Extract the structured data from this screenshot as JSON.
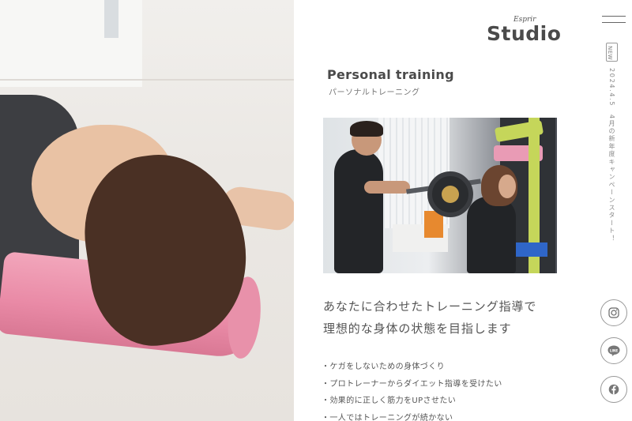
{
  "brand": {
    "script": "Esprir",
    "name": "Studio"
  },
  "news": {
    "badge": "NEW",
    "text": "2024.4.5　4月の新年度キャンペーンスタート！"
  },
  "section": {
    "title": "Personal training",
    "subtitle": "パーソナルトレーニング"
  },
  "lead": {
    "line1": "あなたに合わせたトレーニング指導で",
    "line2": "理想的な身体の状態を目指します"
  },
  "points": [
    "ケガをしないための身体づくり",
    "プロトレーナーからダイエット指導を受けたい",
    "効果的に正しく筋力をUPさせたい",
    "一人ではトレーニングが続かない"
  ],
  "social": [
    {
      "icon": "instagram-icon"
    },
    {
      "icon": "line-icon",
      "label": "LINE"
    },
    {
      "icon": "facebook-icon"
    }
  ],
  "colors": {
    "text": "#555555",
    "accent_pink": "#e98aa6",
    "background": "#ffffff"
  }
}
